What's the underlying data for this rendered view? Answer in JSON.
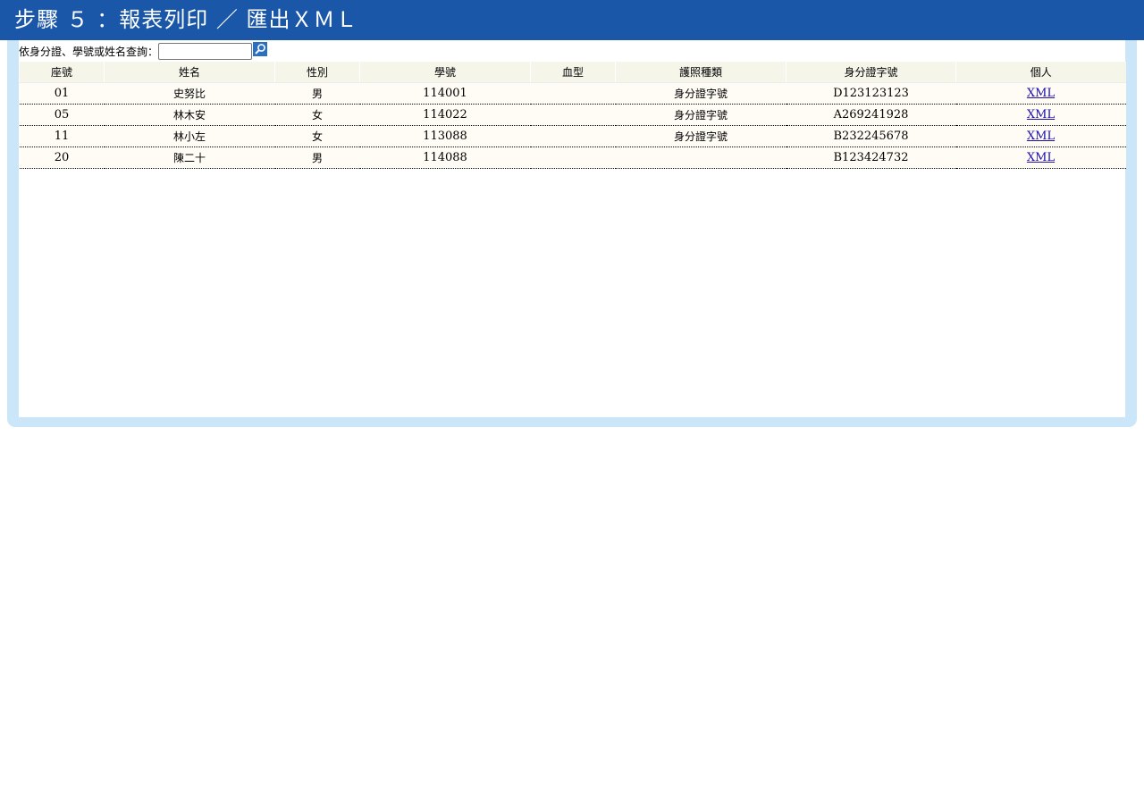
{
  "header": {
    "title": "步驟 ５ ：報表列印 ／ 匯出ＸＭＬ"
  },
  "search": {
    "label": "依身分證、學號或姓名查詢：",
    "value": "",
    "button_icon": "search-icon"
  },
  "table": {
    "columns": [
      "座號",
      "姓名",
      "性別",
      "學號",
      "血型",
      "護照種類",
      "身分證字號",
      "個人"
    ],
    "rows": [
      {
        "seat": "01",
        "name": "史努比",
        "gender": "男",
        "student_id": "114001",
        "blood_type": "",
        "passport_type": "身分證字號",
        "id_number": "D123123123",
        "personal": "XML"
      },
      {
        "seat": "05",
        "name": "林木安",
        "gender": "女",
        "student_id": "114022",
        "blood_type": "",
        "passport_type": "身分證字號",
        "id_number": "A269241928",
        "personal": "XML"
      },
      {
        "seat": "11",
        "name": "林小左",
        "gender": "女",
        "student_id": "113088",
        "blood_type": "",
        "passport_type": "身分證字號",
        "id_number": "B232245678",
        "personal": "XML"
      },
      {
        "seat": "20",
        "name": "陳二十",
        "gender": "男",
        "student_id": "114088",
        "blood_type": "",
        "passport_type": "",
        "id_number": "B123424732",
        "personal": "XML"
      }
    ]
  },
  "colors": {
    "header_bg": "#1a57a8",
    "frame_bg": "#cce6f9",
    "table_header_bg": "#f5f5ea",
    "row_bg": "#fffcf6",
    "link": "#1a0dab"
  }
}
